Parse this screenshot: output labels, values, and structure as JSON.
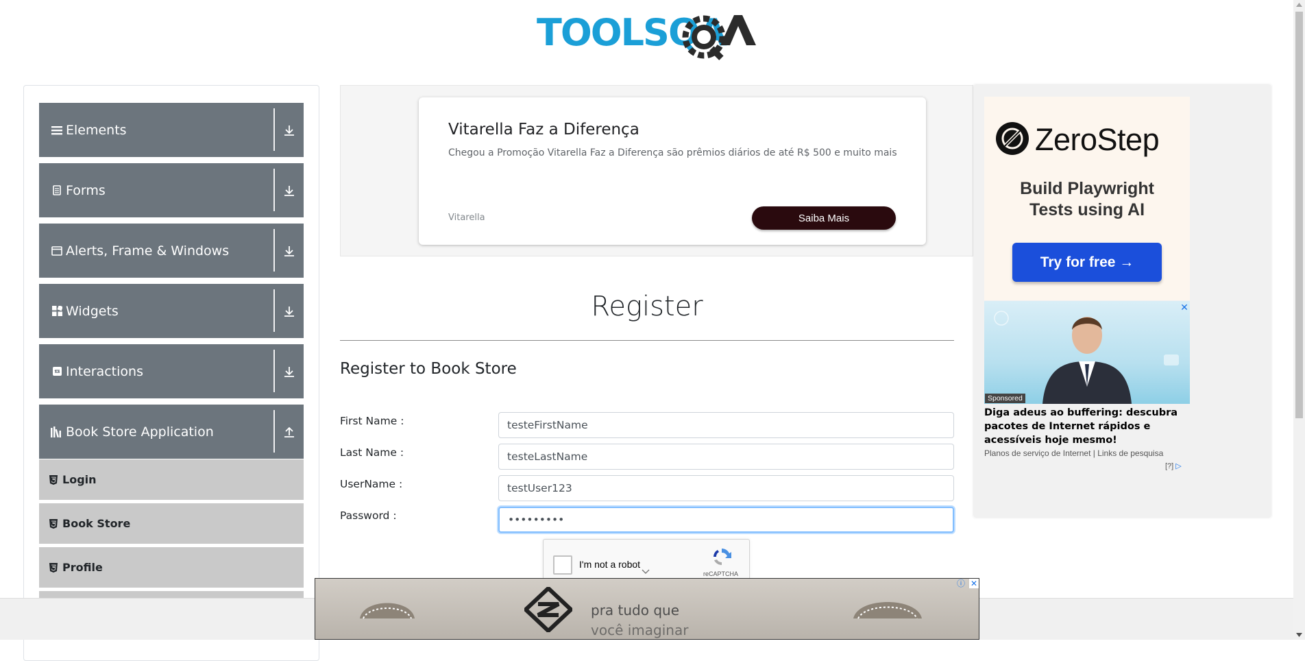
{
  "header": {
    "logo_alt": "TOOLSQA"
  },
  "sidebar": {
    "groups": [
      {
        "label": "Elements",
        "icon": "menu-icon",
        "state": "collapsed"
      },
      {
        "label": "Forms",
        "icon": "document-icon",
        "state": "collapsed"
      },
      {
        "label": "Alerts, Frame & Windows",
        "icon": "window-icon",
        "state": "collapsed"
      },
      {
        "label": "Widgets",
        "icon": "widgets-icon",
        "state": "collapsed"
      },
      {
        "label": "Interactions",
        "icon": "interactions-icon",
        "state": "collapsed"
      },
      {
        "label": "Book Store Application",
        "icon": "books-icon",
        "state": "expanded"
      }
    ],
    "book_store_items": [
      {
        "label": "Login"
      },
      {
        "label": "Book Store"
      },
      {
        "label": "Profile"
      }
    ]
  },
  "top_ad": {
    "title": "Vitarella Faz a Diferença",
    "description": "Chegou a Promoção Vitarella Faz a Diferença são prêmios diários de até R$ 500 e muito mais",
    "brand": "Vitarella",
    "button": "Saiba Mais"
  },
  "register": {
    "title": "Register",
    "subtitle": "Register to Book Store",
    "fields": {
      "first_name": {
        "label": "First Name :",
        "value": "testeFirstName"
      },
      "last_name": {
        "label": "Last Name :",
        "value": "testeLastName"
      },
      "username": {
        "label": "UserName :",
        "value": "testUser123"
      },
      "password": {
        "label": "Password :",
        "value": "•••••••••"
      }
    },
    "captcha": {
      "label": "I'm not a robot",
      "brand": "reCAPTCHA"
    }
  },
  "right_ad": {
    "brand": "ZeroStep",
    "tagline_1": "Build Playwright",
    "tagline_2": "Tests using AI",
    "button": "Try for free →",
    "sponsored_badge": "Sponsored",
    "sponsored_title": "Diga adeus ao buffering: descubra pacotes de Internet rápidos e acessíveis hoje mesmo!",
    "sponsored_sub": "Planos de serviço de Internet | Links de pesquisa",
    "ad_choices": "[?]"
  },
  "bottom_ad": {
    "line1": "pra tudo que",
    "line2": "você imaginar"
  },
  "colors": {
    "sidebar_group": "#6c757d",
    "sidebar_sub": "#c9c9c9",
    "logo_blue": "#1b9fd7",
    "logo_dark": "#2b2b2b",
    "focus": "#80bdff"
  }
}
